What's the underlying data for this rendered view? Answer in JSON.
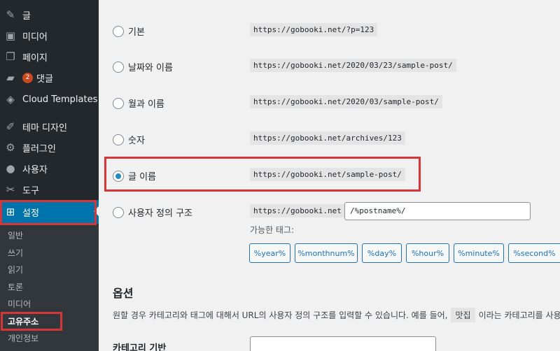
{
  "sidebar": {
    "items": [
      {
        "icon": "pin-icon",
        "glyph": "✎",
        "label": "글"
      },
      {
        "icon": "media-icon",
        "glyph": "▣",
        "label": "미디어"
      },
      {
        "icon": "page-icon",
        "glyph": "❐",
        "label": "페이지"
      },
      {
        "icon": "comment-icon",
        "glyph": "▰",
        "label": "댓글",
        "badge": "2"
      },
      {
        "icon": "cloud-templates-icon",
        "glyph": "◈",
        "label": "Cloud Templates"
      },
      {
        "icon": "appearance-icon",
        "glyph": "✐",
        "label": "테마 디자인"
      },
      {
        "icon": "plugin-icon",
        "glyph": "⚙",
        "label": "플러그인"
      },
      {
        "icon": "user-icon",
        "glyph": "●",
        "label": "사용자"
      },
      {
        "icon": "tools-icon",
        "glyph": "✂",
        "label": "도구"
      },
      {
        "icon": "settings-icon",
        "glyph": "⊞",
        "label": "설정"
      }
    ],
    "submenu": [
      "일반",
      "쓰기",
      "읽기",
      "토론",
      "미디어",
      "고유주소",
      "개인정보"
    ]
  },
  "permalink": {
    "options": [
      {
        "label": "기본",
        "example": "https://gobooki.net/?p=123",
        "checked": false
      },
      {
        "label": "날짜와 이름",
        "example": "https://gobooki.net/2020/03/23/sample-post/",
        "checked": false
      },
      {
        "label": "월과 이름",
        "example": "https://gobooki.net/2020/03/sample-post/",
        "checked": false
      },
      {
        "label": "숫자",
        "example": "https://gobooki.net/archives/123",
        "checked": false
      },
      {
        "label": "글 이름",
        "example": "https://gobooki.net/sample-post/",
        "checked": true
      }
    ],
    "custom": {
      "label": "사용자 정의 구조",
      "base": "https://gobooki.net",
      "value": "/%postname%/"
    },
    "tags_label": "가능한 태그:",
    "tags": [
      "%year%",
      "%monthnum%",
      "%day%",
      "%hour%",
      "%minute%",
      "%second%"
    ]
  },
  "options": {
    "title": "옵션",
    "desc_before": "원할 경우 카테고리와 태그에 대해서 URL의 사용자 정의 구조를 입력할 수 있습니다. 예를 들어,",
    "desc_code": "맛집",
    "desc_after": "이라는 카테고리를 사용",
    "category_base_label": "카테고리 기반"
  },
  "colors": {
    "sidebar_bg": "#23282d",
    "active_bg": "#0073aa",
    "highlight_box": "#d63638",
    "tag_color": "#2271b1"
  }
}
